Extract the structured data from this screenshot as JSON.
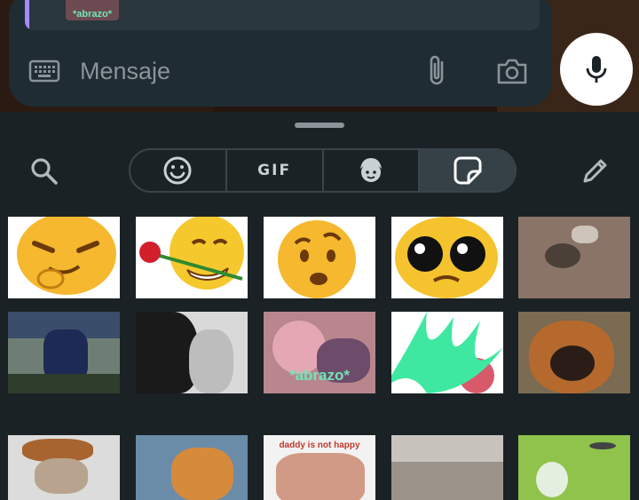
{
  "composer": {
    "quote_thumb_caption": "*abrazo*",
    "placeholder": "Mensaje"
  },
  "panel": {
    "tabs": [
      {
        "label": "",
        "icon": "emoji-icon"
      },
      {
        "label": "GIF",
        "icon": "gif-icon"
      },
      {
        "label": "",
        "icon": "avatar-icon"
      },
      {
        "label": "",
        "icon": "sticker-icon"
      }
    ],
    "active_tab": 3
  },
  "stickers": {
    "hug_caption": "*abrazo*",
    "daddy_caption": "daddy is not happy"
  },
  "colors": {
    "accent_green": "#3ee8a0",
    "quote_bar": "#a78bfa",
    "panel_bg": "#1b2226"
  }
}
